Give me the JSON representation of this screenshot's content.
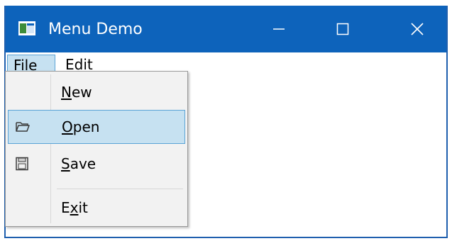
{
  "window": {
    "title": "Menu Demo",
    "titlebar_color": "#0d63bb",
    "app_icon": "window-app-icon",
    "controls": {
      "minimize": "minimize-icon",
      "maximize": "maximize-icon",
      "close": "close-icon"
    }
  },
  "menubar": {
    "items": [
      {
        "mnemonic": "F",
        "rest": "ile",
        "state": "open"
      },
      {
        "mnemonic": "E",
        "rest": "dit",
        "state": "closed"
      }
    ]
  },
  "file_menu": {
    "items": [
      {
        "pre": "",
        "mnemonic": "N",
        "rest": "ew",
        "icon": null,
        "highlighted": false
      },
      {
        "pre": "",
        "mnemonic": "O",
        "rest": "pen",
        "icon": "folder-open-icon",
        "highlighted": true
      },
      {
        "pre": "",
        "mnemonic": "S",
        "rest": "ave",
        "icon": "floppy-disk-icon",
        "highlighted": false
      },
      {
        "pre": "E",
        "mnemonic": "x",
        "rest": "it",
        "icon": null,
        "highlighted": false
      }
    ],
    "highlight_color": "#c6e1f1",
    "highlight_border": "#5aa3d6"
  }
}
